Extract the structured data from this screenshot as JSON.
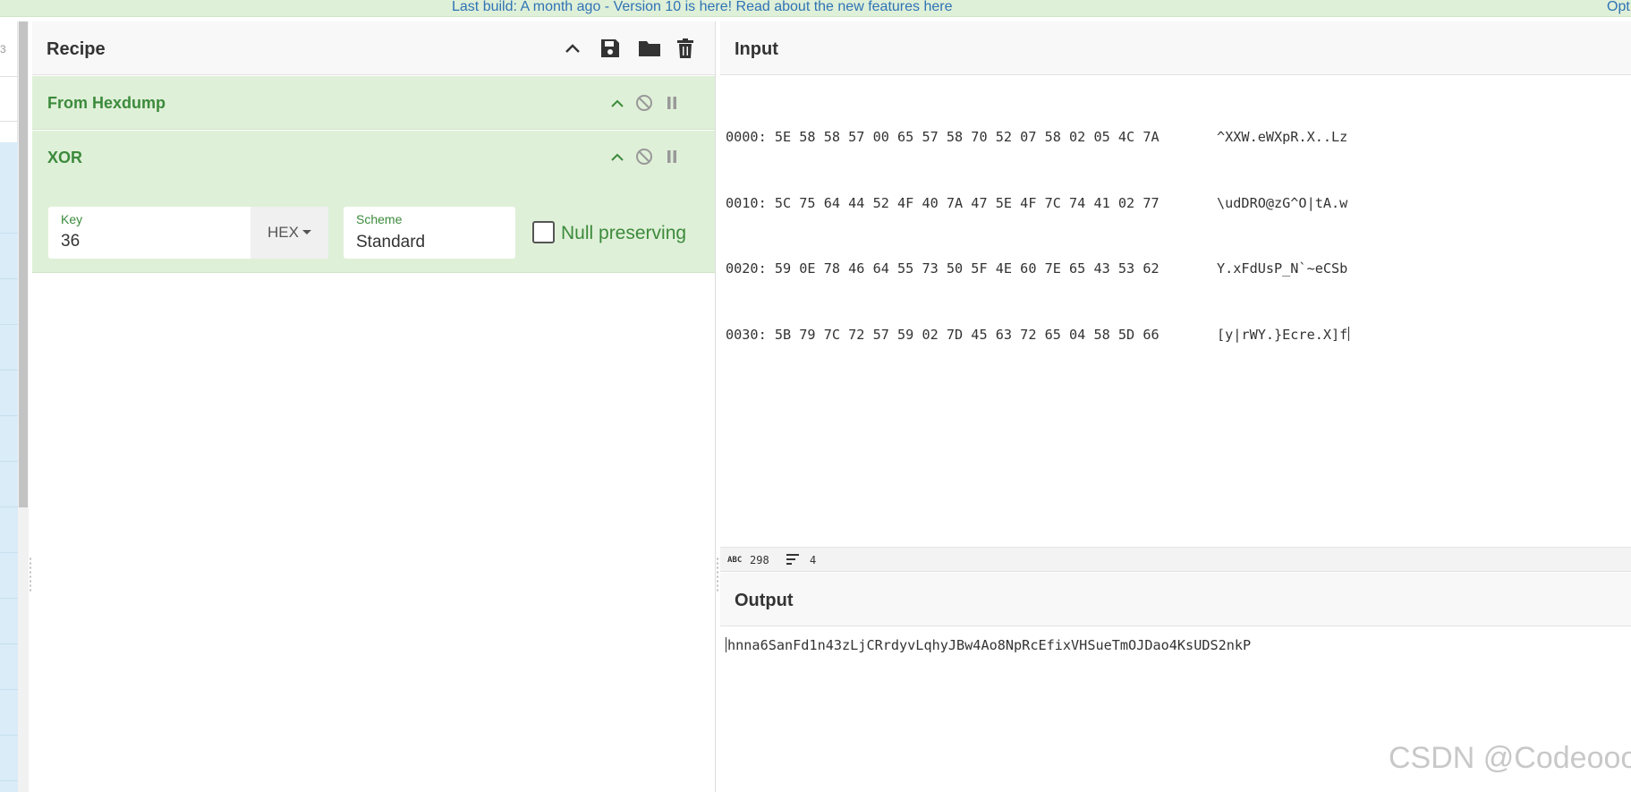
{
  "banner": {
    "message": "Last build: A month ago - Version 10 is here! Read about the new features here",
    "options_link": "Opt"
  },
  "left_strip": {
    "partial_text": "3"
  },
  "recipe": {
    "title": "Recipe",
    "icons": [
      "collapse-all-icon",
      "save-icon",
      "load-folder-icon",
      "trash-icon"
    ],
    "operations": [
      {
        "name": "From Hexdump"
      },
      {
        "name": "XOR",
        "key_label": "Key",
        "key_value": "36",
        "key_format": "HEX",
        "scheme_label": "Scheme",
        "scheme_value": "Standard",
        "null_preserving_label": "Null preserving"
      }
    ]
  },
  "input": {
    "title": "Input",
    "hex_lines": [
      "0000: 5E 58 58 57 00 65 57 58 70 52 07 58 02 05 4C 7A",
      "0010: 5C 75 64 44 52 4F 40 7A 47 5E 4F 7C 74 41 02 77",
      "0020: 59 0E 78 46 64 55 73 50 5F 4E 60 7E 65 43 53 62",
      "0030: 5B 79 7C 72 57 59 02 7D 45 63 72 65 04 58 5D 66"
    ],
    "ascii_lines": [
      "^XXW.eWXpR.X..Lz",
      "\\udDRO@zG^O|tA.w",
      "Y.xFdUsP_N`~eCSb",
      "[y|rWY.}Ecre.X]f"
    ],
    "stats": {
      "chars": "298",
      "lines": "4"
    }
  },
  "output": {
    "title": "Output",
    "text": "hnna6SanFd1n43zLjCRrdyvLqhyJBw4Ao8NpRcEfixVHSueTmOJDao4KsUDS2nkP"
  },
  "watermark": "CSDN @Codeooo"
}
